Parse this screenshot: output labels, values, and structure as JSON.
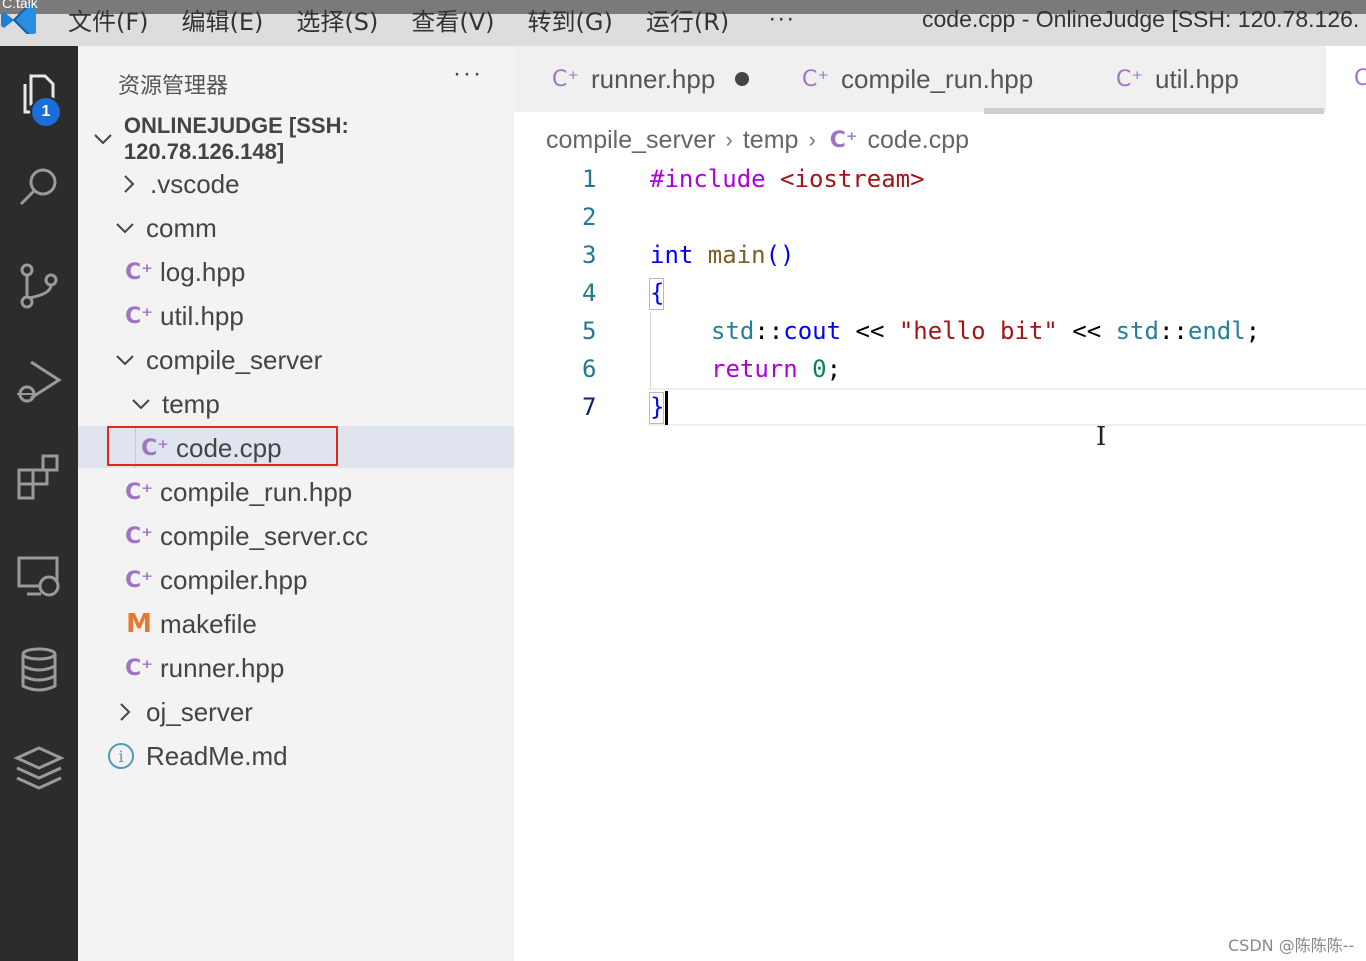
{
  "titlebar": {
    "logo_overlay": "C.talk",
    "menu": [
      "文件(F)",
      "编辑(E)",
      "选择(S)",
      "查看(V)",
      "转到(G)",
      "运行(R)"
    ],
    "more": "···",
    "window_title": "code.cpp - OnlineJudge [SSH: 120.78.126."
  },
  "activity": {
    "explorer_badge": "1",
    "icons": [
      "files-icon",
      "search-icon",
      "source-control-icon",
      "run-debug-icon",
      "extensions-icon",
      "remote-explorer-icon",
      "database-icon",
      "layers-icon"
    ]
  },
  "sidebar": {
    "title": "资源管理器",
    "more": "···",
    "root": "ONLINEJUDGE [SSH: 120.78.126.148]",
    "items": [
      {
        "label": ".vscode",
        "type": "folder",
        "state": "collapsed"
      },
      {
        "label": "comm",
        "type": "folder",
        "state": "expanded"
      },
      {
        "label": "log.hpp",
        "type": "cpp"
      },
      {
        "label": "util.hpp",
        "type": "cpp"
      },
      {
        "label": "compile_server",
        "type": "folder",
        "state": "expanded"
      },
      {
        "label": "temp",
        "type": "folder",
        "state": "expanded"
      },
      {
        "label": "code.cpp",
        "type": "cpp",
        "selected": true
      },
      {
        "label": "compile_run.hpp",
        "type": "cpp"
      },
      {
        "label": "compile_server.cc",
        "type": "cpp"
      },
      {
        "label": "compiler.hpp",
        "type": "cpp"
      },
      {
        "label": "makefile",
        "type": "makefile"
      },
      {
        "label": "runner.hpp",
        "type": "cpp"
      },
      {
        "label": "oj_server",
        "type": "folder",
        "state": "collapsed"
      },
      {
        "label": "ReadMe.md",
        "type": "info"
      }
    ]
  },
  "tabs": [
    {
      "label": "runner.hpp",
      "dirty": true
    },
    {
      "label": "compile_run.hpp",
      "dirty": false
    },
    {
      "label": "util.hpp",
      "dirty": false
    }
  ],
  "breadcrumb": [
    "compile_server",
    "temp",
    "code.cpp"
  ],
  "editor": {
    "line_numbers": [
      "1",
      "2",
      "3",
      "4",
      "5",
      "6",
      "7"
    ],
    "tokens": {
      "l1_directive": "#include",
      "l1_header": " <iostream>",
      "l3_type": "int",
      "l3_fn": " main",
      "l3_parens": "()",
      "l4_brace": "{",
      "l5_ns1": "std",
      "l5_sep1": "::",
      "l5_cout": "cout",
      "l5_op1": " << ",
      "l5_str": "\"hello bit\"",
      "l5_op2": " << ",
      "l5_ns2": "std",
      "l5_sep2": "::",
      "l5_endl": "endl",
      "l5_semi": ";",
      "l6_return": "return",
      "l6_num": "0",
      "l6_semi": ";",
      "l7_brace": "}"
    }
  },
  "watermark": "CSDN @陈陈陈--",
  "colors": {
    "activity_bg": "#2c2c2c",
    "sidebar_bg": "#f3f3f3",
    "badge": "#1a6ed8",
    "cpp_icon": "#a074c4",
    "makefile_icon": "#e37933",
    "highlight_box": "#e0281e"
  }
}
